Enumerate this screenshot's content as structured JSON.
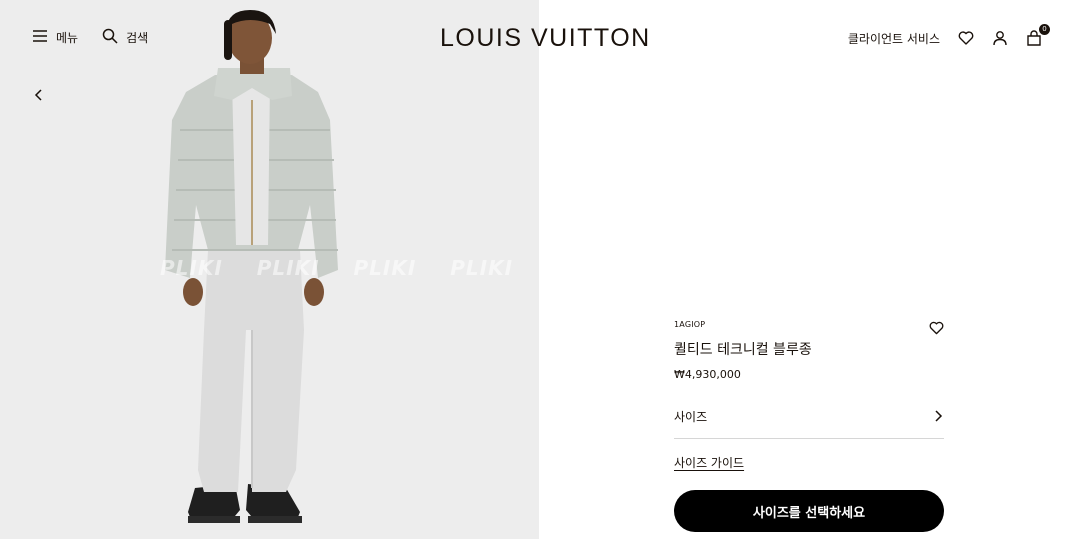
{
  "header": {
    "menu_label": "메뉴",
    "search_label": "검색",
    "logo_text": "LOUIS VUITTON",
    "client_service_label": "클라이언트 서비스",
    "cart_count": "0"
  },
  "hero": {
    "watermark": "PLIKI PLIKI PLIKI PLIKI PLI"
  },
  "product": {
    "sku": "1AGIOP",
    "name": "퀼티드 테크니컬 블루종",
    "price": "₩4,930,000",
    "size_label": "사이즈",
    "size_guide_label": "사이즈 가이드",
    "cta_label": "사이즈를 선택하세요"
  },
  "colors": {
    "brand_dark": "#19110b",
    "cta_bg": "#000000",
    "image_bg": "#ededed"
  }
}
